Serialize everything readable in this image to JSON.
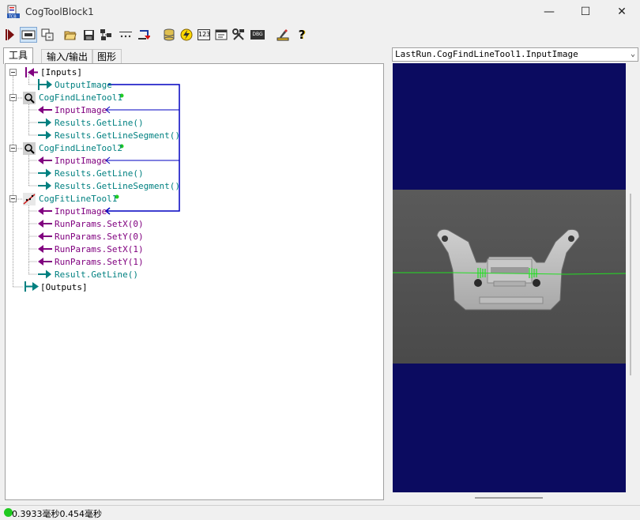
{
  "window": {
    "title": "CogToolBlock1",
    "minimize_glyph": "—",
    "maximize_glyph": "☐",
    "close_glyph": "✕"
  },
  "toolbar": {
    "icons": [
      "run-icon",
      "show-tool-tips-icon",
      "attach-icon",
      "open-folder-icon",
      "save-icon",
      "network-icon",
      "ellipsis-icon",
      "reset-icon",
      "database-icon",
      "lightning-icon",
      "number-123-icon",
      "terminal-icon",
      "tools-icon",
      "debug-icon",
      "pencil-ruler-icon",
      "help-icon"
    ],
    "number_label": "123",
    "debug_label": "DBG",
    "help_label": "?"
  },
  "tabs": [
    {
      "label": "工具",
      "active": true
    },
    {
      "label": "输入/输出",
      "active": false
    },
    {
      "label": "图形",
      "active": false
    }
  ],
  "tree": {
    "inputs": "[Inputs]",
    "output_image": "OutputImage",
    "find_tool_1": "CogFindLineTool1",
    "find_tool_1_input": "InputImage",
    "find_tool_1_getline": "Results.GetLine()",
    "find_tool_1_getseg": "Results.GetLineSegment()",
    "find_tool_2": "CogFindLineTool2",
    "find_tool_2_input": "InputImage",
    "find_tool_2_getline": "Results.GetLine()",
    "find_tool_2_getseg": "Results.GetLineSegment()",
    "fit_tool_1": "CogFitLineTool1",
    "fit_tool_1_input": "InputImage",
    "fit_setx0": "RunParams.SetX(0)",
    "fit_sety0": "RunParams.SetY(0)",
    "fit_setx1": "RunParams.SetX(1)",
    "fit_sety1": "RunParams.SetY(1)",
    "fit_result": "Result.GetLine()",
    "outputs": "[Outputs]"
  },
  "display": {
    "selector": "LastRun.CogFindLineTool1.InputImage",
    "background_color": "#0b0b60",
    "line_color": "#22dd22"
  },
  "status": {
    "text": "0.3933毫秒0.454毫秒",
    "indicator_color": "#1ec91e"
  }
}
